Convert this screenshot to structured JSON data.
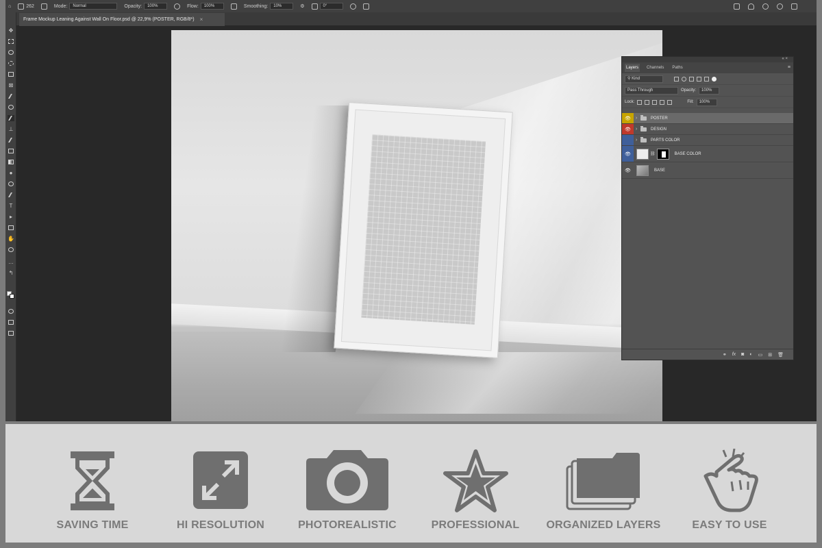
{
  "options_bar": {
    "brush_size": "262",
    "mode_label": "Mode:",
    "mode_value": "Normal",
    "opacity_label": "Opacity:",
    "opacity_value": "100%",
    "flow_label": "Flow:",
    "flow_value": "100%",
    "smoothing_label": "Smoothing:",
    "smoothing_value": "10%",
    "angle_value": "0°"
  },
  "document_tab": {
    "title": "Frame Mockup Leaning Against Wall On Floor.psd @ 22,9% (POSTER, RGB/8*)",
    "close_glyph": "×"
  },
  "layers_panel": {
    "tabs": [
      "Layers",
      "Channels",
      "Paths"
    ],
    "menu_glyph": "≡",
    "collapse_glyph": "«  ×",
    "filter_label": "Kind",
    "blend_mode": "Pass Through",
    "opacity_label": "Opacity:",
    "opacity_value": "100%",
    "lock_label": "Lock:",
    "fill_label": "Fill:",
    "fill_value": "100%",
    "layers": [
      {
        "name": "POSTER",
        "type": "group",
        "color": "#c7a400",
        "selected": true
      },
      {
        "name": "DESIGN",
        "type": "group",
        "color": "#c0392b",
        "selected": false
      },
      {
        "name": "PARTS COLOR",
        "type": "group",
        "color": "#3f5f9a",
        "selected": false
      },
      {
        "name": "BASE COLOR",
        "type": "layer-with-mask",
        "color": "#3f5f9a",
        "selected": false
      },
      {
        "name": "BASE",
        "type": "smart-object",
        "color": "",
        "selected": false
      }
    ],
    "footer_icons": [
      "link-icon",
      "fx-icon",
      "mask-icon",
      "adjustment-icon",
      "group-icon",
      "new-layer-icon",
      "trash-icon"
    ],
    "footer_fx": "fx"
  },
  "features": [
    {
      "label": "SAVING TIME",
      "icon": "hourglass-icon"
    },
    {
      "label": "HI RESOLUTION",
      "icon": "expand-arrows-icon"
    },
    {
      "label": "PHOTOREALISTIC",
      "icon": "camera-icon"
    },
    {
      "label": "PROFESSIONAL",
      "icon": "star-icon"
    },
    {
      "label": "ORGANIZED LAYERS",
      "icon": "layers-folder-icon"
    },
    {
      "label": "EASY TO USE",
      "icon": "pointing-hand-icon"
    }
  ],
  "colors": {
    "feature_icon": "#6f6f6f",
    "feature_bg": "#d8d8d8",
    "panel_bg": "#535353",
    "workspace_bg": "#282828"
  }
}
